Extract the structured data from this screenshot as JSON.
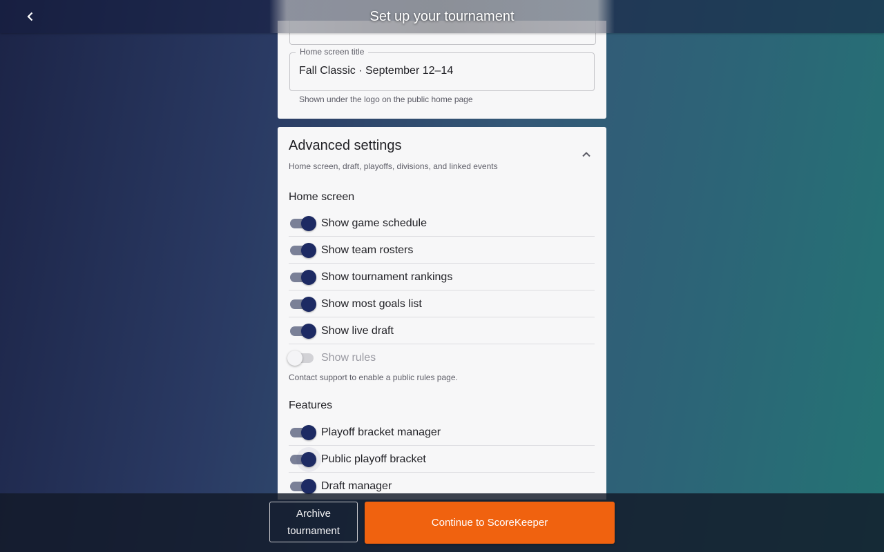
{
  "header": {
    "title": "Set up your tournament"
  },
  "home_title_field": {
    "label": "Home screen title",
    "value": "Fall Classic · September 12–14",
    "helper": "Shown under the logo on the public home page"
  },
  "advanced": {
    "title": "Advanced settings",
    "subtitle": "Home screen, draft, playoffs, divisions, and linked events",
    "home_section": "Home screen",
    "home_items": [
      {
        "label": "Show game schedule",
        "on": true
      },
      {
        "label": "Show team rosters",
        "on": true
      },
      {
        "label": "Show tournament rankings",
        "on": true
      },
      {
        "label": "Show most goals list",
        "on": true
      },
      {
        "label": "Show live draft",
        "on": true
      },
      {
        "label": "Show rules",
        "on": false,
        "disabled": true
      }
    ],
    "rules_note": "Contact support to enable a public rules page.",
    "features_section": "Features",
    "feature_items": [
      {
        "label": "Playoff bracket manager",
        "on": true
      },
      {
        "label": "Public playoff bracket",
        "on": true
      },
      {
        "label": "Draft manager",
        "on": true
      }
    ]
  },
  "footer": {
    "archive_label": "Archive tournament",
    "continue_label": "Continue to ScoreKeeper"
  },
  "colors": {
    "accent": "#f0620f",
    "switch_on": "#1d2a63"
  }
}
